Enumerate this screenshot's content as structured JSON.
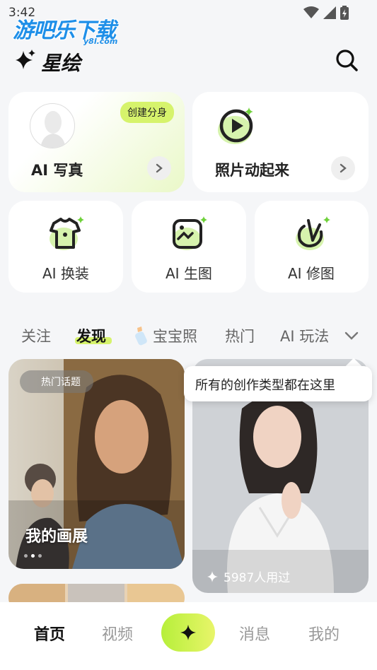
{
  "status": {
    "time": "3:42"
  },
  "watermark": {
    "main": "游吧乐下载",
    "sub": "y8l.com"
  },
  "header": {
    "title": "星绘"
  },
  "features": {
    "ai_portrait": {
      "label": "AI 写真",
      "badge": "创建分身"
    },
    "photo_animate": {
      "label": "照片动起来"
    },
    "outfit": {
      "label": "AI 换装"
    },
    "generate": {
      "label": "AI 生图"
    },
    "retouch": {
      "label": "AI 修图"
    }
  },
  "tabs": [
    {
      "label": "关注"
    },
    {
      "label": "发现"
    },
    {
      "label": "宝宝照"
    },
    {
      "label": "热门"
    },
    {
      "label": "AI 玩法"
    }
  ],
  "tooltip": {
    "text": "所有的创作类型都在这里"
  },
  "feed": [
    {
      "tag": "热门话题",
      "title": "我的画展"
    },
    {
      "used": "5987人用过"
    }
  ],
  "bottom_nav": [
    {
      "label": "首页"
    },
    {
      "label": "视频"
    },
    {
      "label": "消息"
    },
    {
      "label": "我的"
    }
  ],
  "colors": {
    "accent": "#d6f36c",
    "icon_green": "#6fd13a"
  }
}
